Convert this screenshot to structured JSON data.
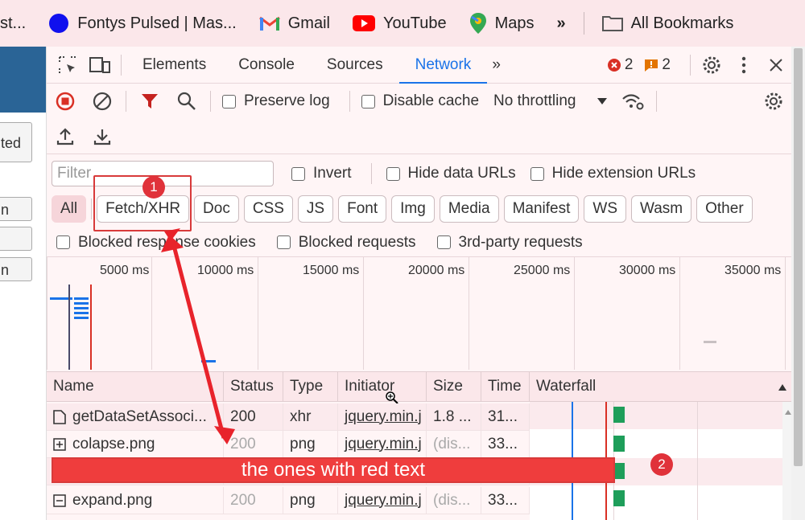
{
  "bookmarks": [
    {
      "label": "st...",
      "icon": "page-icon"
    },
    {
      "label": "Fontys Pulsed | Mas...",
      "icon": "blue-circle-icon"
    },
    {
      "label": "Gmail",
      "icon": "gmail-icon"
    },
    {
      "label": "YouTube",
      "icon": "youtube-icon"
    },
    {
      "label": "Maps",
      "icon": "maps-icon"
    },
    {
      "label": "»",
      "icon": "chevron-icon"
    },
    {
      "label": "All Bookmarks",
      "icon": "folder-icon"
    }
  ],
  "left_page": {
    "button_1": "ted",
    "button_2": "n",
    "button_3": "",
    "button_4": "n"
  },
  "devtools": {
    "tabs": [
      "Elements",
      "Console",
      "Sources",
      "Network"
    ],
    "active_tab": "Network",
    "more_tabs": "»",
    "error_count": "2",
    "warning_count": "2"
  },
  "toolbar": {
    "preserve_log": "Preserve log",
    "disable_cache": "Disable cache",
    "throttling": "No throttling"
  },
  "filter": {
    "placeholder": "Filter",
    "invert": "Invert",
    "hide_data_urls": "Hide data URLs",
    "hide_extension_urls": "Hide extension URLs"
  },
  "type_filters": [
    "All",
    "Fetch/XHR",
    "Doc",
    "CSS",
    "JS",
    "Font",
    "Img",
    "Media",
    "Manifest",
    "WS",
    "Wasm",
    "Other"
  ],
  "blocked": {
    "blocked_response_cookies": "Blocked response cookies",
    "blocked_requests": "Blocked requests",
    "third_party_requests": "3rd-party requests"
  },
  "overview_ticks": [
    "5000 ms",
    "10000 ms",
    "15000 ms",
    "20000 ms",
    "25000 ms",
    "30000 ms",
    "35000 ms"
  ],
  "table": {
    "columns": [
      "Name",
      "Status",
      "Type",
      "Initiator",
      "Size",
      "Time",
      "Waterfall"
    ],
    "rows": [
      {
        "name": "getDataSetAssoci...",
        "status": "200",
        "type": "xhr",
        "initiator": "jquery.min.j",
        "size": "1.8 ...",
        "time": "31...",
        "icon": "document-icon"
      },
      {
        "name": "colapse.png",
        "status": "200",
        "type": "png",
        "initiator": "jquery.min.j",
        "size": "(dis...",
        "time": "33...",
        "icon": "plus-box-icon"
      },
      {
        "name": "",
        "status": "",
        "type": "",
        "initiator": "",
        "size": "",
        "time": "",
        "icon": ""
      },
      {
        "name": "expand.png",
        "status": "200",
        "type": "png",
        "initiator": "jquery.min.j",
        "size": "(dis...",
        "time": "33...",
        "icon": "minus-box-icon"
      }
    ]
  },
  "annotations": {
    "badge_1": "1",
    "badge_2": "2",
    "red_bar_text": "the ones with red text"
  },
  "colors": {
    "accent": "#1a73e8",
    "annotation_red": "#e0323a",
    "devtools_bg": "#fff5f6"
  }
}
